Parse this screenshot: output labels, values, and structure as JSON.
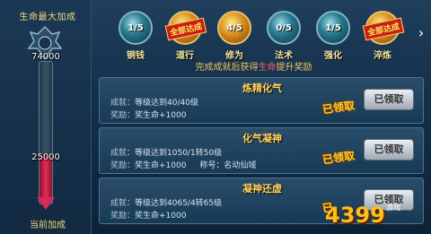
{
  "meter": {
    "title": "生命最大加成",
    "max_value": "74000",
    "current_value": "25000",
    "bottom_label": "当前加成",
    "fill_fraction": 0.34
  },
  "orbs": [
    {
      "label": "铜钱",
      "value": "1/5",
      "style": "teal",
      "stamp": ""
    },
    {
      "label": "道行",
      "value": "",
      "style": "gold",
      "stamp": "全部达成"
    },
    {
      "label": "修为",
      "value": "4/5",
      "style": "gold",
      "stamp": ""
    },
    {
      "label": "法术",
      "value": "0/5",
      "style": "teal",
      "stamp": ""
    },
    {
      "label": "强化",
      "value": "1/5",
      "style": "teal",
      "stamp": ""
    },
    {
      "label": "淬炼",
      "value": "",
      "style": "gold",
      "stamp": "全部达成"
    }
  ],
  "progress_note": {
    "prefix": "完成成就后获得",
    "highlight": "生命",
    "suffix": "提升奖励"
  },
  "achievements": [
    {
      "title": "炼精化气",
      "line1_label": "成就：",
      "line1": "等级达到40/40级",
      "line2_label": "奖励：",
      "line2": "奖生命+1000",
      "line2_extra": "",
      "status": "已领取",
      "button": "已领取"
    },
    {
      "title": "化气凝神",
      "line1_label": "成就：",
      "line1": "等级达到1050/1转50级",
      "line2_label": "奖励：",
      "line2": "奖生命+1000",
      "line2_extra": "称号：名动仙域",
      "status": "已领取",
      "button": "已领取"
    },
    {
      "title": "凝神还虚",
      "line1_label": "成就：",
      "line1": "等级达到4065/4转65级",
      "line2_label": "奖励：",
      "line2": "奖生命+1000",
      "line2_extra": "",
      "status": "已",
      "button": "已领取"
    }
  ],
  "watermark": {
    "text": "4399",
    "sub": "游戏"
  },
  "colors": {
    "accent_gold": "#ffd35c",
    "claimed": "#ffcf2e",
    "meter_fill": "#e0305a"
  }
}
